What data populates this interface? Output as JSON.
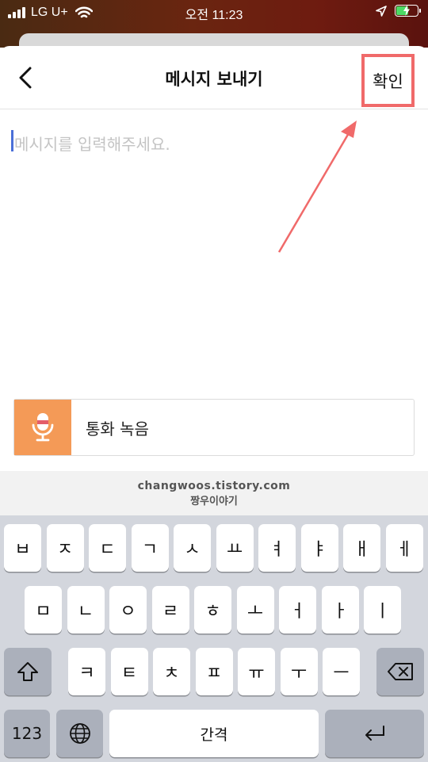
{
  "status_bar": {
    "carrier": "LG U+",
    "time": "오전 11:23",
    "battery_level": 0.6,
    "battery_color": "#4cd964",
    "icons": [
      "signal-icon",
      "wifi-icon",
      "location-icon",
      "battery-charging-icon"
    ]
  },
  "header": {
    "title": "메시지 보내기",
    "confirm_label": "확인",
    "highlight_color": "#f06a6a"
  },
  "message_input": {
    "placeholder": "메시지를 입력해주세요.",
    "value": ""
  },
  "record_button": {
    "label": "통화 녹음",
    "icon": "microphone-icon",
    "accent": "#f49a57"
  },
  "keyboard": {
    "watermark_line1": "changwoos.tistory.com",
    "watermark_line2": "짱우이야기",
    "row1": [
      "ㅂ",
      "ㅈ",
      "ㄷ",
      "ㄱ",
      "ㅅ",
      "ㅛ",
      "ㅕ",
      "ㅑ",
      "ㅐ",
      "ㅔ"
    ],
    "row2": [
      "ㅁ",
      "ㄴ",
      "ㅇ",
      "ㄹ",
      "ㅎ",
      "ㅗ",
      "ㅓ",
      "ㅏ",
      "ㅣ"
    ],
    "row3": [
      "ㅋ",
      "ㅌ",
      "ㅊ",
      "ㅍ",
      "ㅠ",
      "ㅜ",
      "ㅡ"
    ],
    "numbers_label": "123",
    "space_label": "간격",
    "icons": [
      "shift-icon",
      "backspace-icon",
      "globe-icon",
      "return-icon"
    ]
  }
}
